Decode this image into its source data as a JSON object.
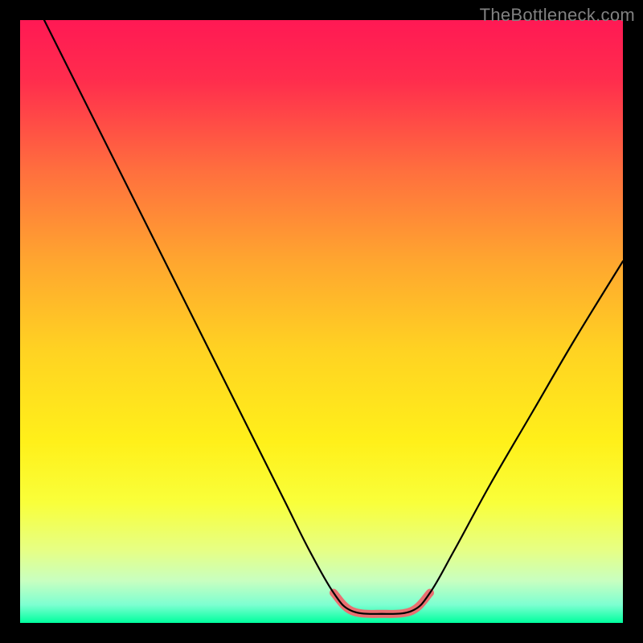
{
  "watermark": "TheBottleneck.com",
  "chart_data": {
    "type": "line",
    "title": "",
    "xlabel": "",
    "ylabel": "",
    "xlim": [
      0,
      100
    ],
    "ylim": [
      0,
      100
    ],
    "grid": false,
    "legend": false,
    "background": {
      "type": "vertical-gradient",
      "stops": [
        {
          "offset": 0.0,
          "color": "#ff1954"
        },
        {
          "offset": 0.1,
          "color": "#ff2d4d"
        },
        {
          "offset": 0.25,
          "color": "#ff6f3e"
        },
        {
          "offset": 0.4,
          "color": "#ffa62f"
        },
        {
          "offset": 0.55,
          "color": "#ffd322"
        },
        {
          "offset": 0.7,
          "color": "#fff01a"
        },
        {
          "offset": 0.8,
          "color": "#f9ff3a"
        },
        {
          "offset": 0.88,
          "color": "#e6ff85"
        },
        {
          "offset": 0.93,
          "color": "#c8ffc0"
        },
        {
          "offset": 0.97,
          "color": "#7dffd1"
        },
        {
          "offset": 1.0,
          "color": "#00ff9e"
        }
      ]
    },
    "series": [
      {
        "name": "bottleneck-curve",
        "stroke": "#000000",
        "stroke_width": 2.2,
        "points": [
          {
            "x": 4,
            "y": 100
          },
          {
            "x": 8,
            "y": 92
          },
          {
            "x": 12,
            "y": 84
          },
          {
            "x": 16,
            "y": 76
          },
          {
            "x": 20,
            "y": 68
          },
          {
            "x": 24,
            "y": 60
          },
          {
            "x": 28,
            "y": 52
          },
          {
            "x": 32,
            "y": 44
          },
          {
            "x": 36,
            "y": 36
          },
          {
            "x": 40,
            "y": 28
          },
          {
            "x": 44,
            "y": 20
          },
          {
            "x": 48,
            "y": 12
          },
          {
            "x": 52,
            "y": 5
          },
          {
            "x": 55,
            "y": 2
          },
          {
            "x": 60,
            "y": 1.5
          },
          {
            "x": 65,
            "y": 2
          },
          {
            "x": 68,
            "y": 5
          },
          {
            "x": 72,
            "y": 12
          },
          {
            "x": 78,
            "y": 23
          },
          {
            "x": 85,
            "y": 35
          },
          {
            "x": 92,
            "y": 47
          },
          {
            "x": 100,
            "y": 60
          }
        ]
      },
      {
        "name": "optimal-zone-highlight",
        "stroke": "#e96f71",
        "stroke_width": 10,
        "linecap": "round",
        "points": [
          {
            "x": 52,
            "y": 5
          },
          {
            "x": 55,
            "y": 2
          },
          {
            "x": 60,
            "y": 1.5
          },
          {
            "x": 65,
            "y": 2
          },
          {
            "x": 68,
            "y": 5
          }
        ]
      }
    ]
  }
}
